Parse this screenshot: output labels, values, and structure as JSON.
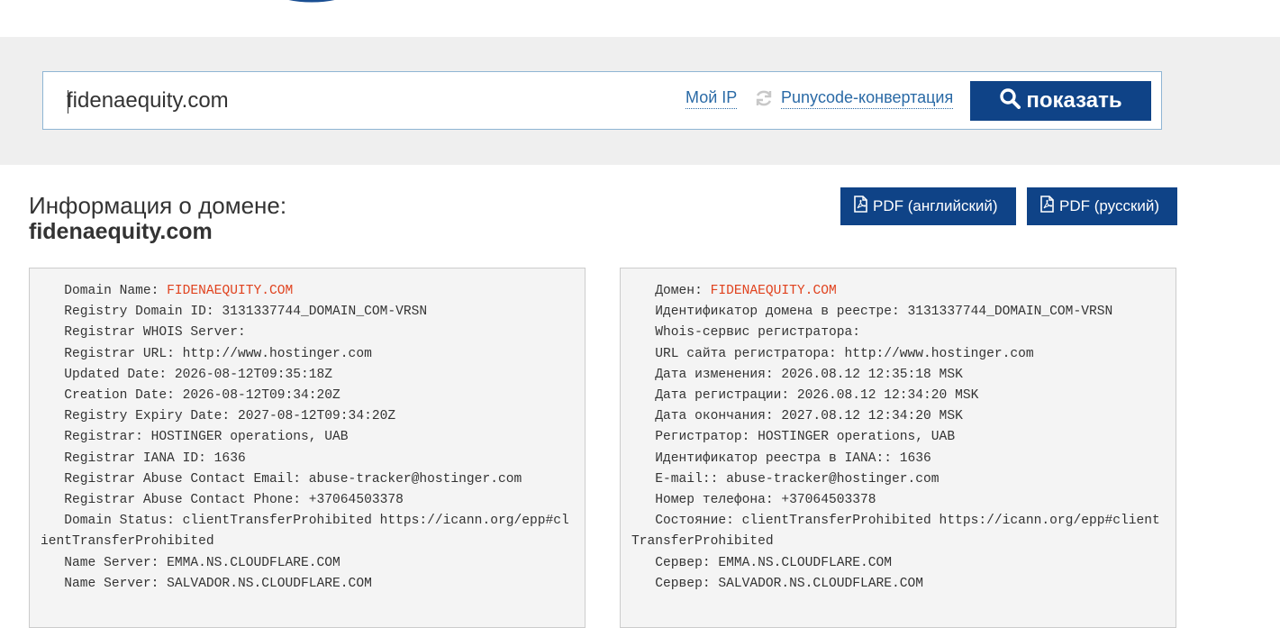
{
  "search": {
    "value": "fidenaequity.com",
    "my_ip_label": "Мой IP",
    "punycode_label": "Punycode-конвертация",
    "show_label": "показать"
  },
  "info": {
    "heading": "Информация о домене:",
    "domain": "fidenaequity.com",
    "pdf_en_label": "PDF (английский)",
    "pdf_ru_label": "PDF (русский)"
  },
  "whois_en": [
    {
      "prefix": "   Domain Name: ",
      "value": "FIDENAEQUITY.COM"
    },
    {
      "text": "   Registry Domain ID: 3131337744_DOMAIN_COM-VRSN"
    },
    {
      "text": "   Registrar WHOIS Server:"
    },
    {
      "text": "   Registrar URL: http://www.hostinger.com"
    },
    {
      "text": "   Updated Date: 2026-08-12T09:35:18Z"
    },
    {
      "text": "   Creation Date: 2026-08-12T09:34:20Z"
    },
    {
      "text": "   Registry Expiry Date: 2027-08-12T09:34:20Z"
    },
    {
      "text": "   Registrar: HOSTINGER operations, UAB"
    },
    {
      "text": "   Registrar IANA ID: 1636"
    },
    {
      "text": "   Registrar Abuse Contact Email: abuse-tracker@hostinger.com"
    },
    {
      "text": "   Registrar Abuse Contact Phone: +37064503378"
    },
    {
      "text": "   Domain Status: clientTransferProhibited https://icann.org/epp#clientTransferProhibited"
    },
    {
      "text": "   Name Server: EMMA.NS.CLOUDFLARE.COM"
    },
    {
      "text": "   Name Server: SALVADOR.NS.CLOUDFLARE.COM"
    }
  ],
  "whois_ru": [
    {
      "prefix": "   Домен: ",
      "value": "FIDENAEQUITY.COM"
    },
    {
      "text": "   Идентификатор домена в реестре: 3131337744_DOMAIN_COM-VRSN"
    },
    {
      "text": "   Whois-сервис регистратора:"
    },
    {
      "text": "   URL сайта регистратора: http://www.hostinger.com"
    },
    {
      "text": "   Дата изменения: 2026.08.12 12:35:18 MSK"
    },
    {
      "text": "   Дата регистрации: 2026.08.12 12:34:20 MSK"
    },
    {
      "text": "   Дата окончания: 2027.08.12 12:34:20 MSK"
    },
    {
      "text": "   Регистратор: HOSTINGER operations, UAB"
    },
    {
      "text": "   Идентификатор реестра в IANA:: 1636"
    },
    {
      "text": "   E-mail:: abuse-tracker@hostinger.com"
    },
    {
      "text": "   Номер телефона: +37064503378"
    },
    {
      "text": "   Состояние: clientTransferProhibited https://icann.org/epp#clientTransferProhibited"
    },
    {
      "text": "   Сервер: EMMA.NS.CLOUDFLARE.COM"
    },
    {
      "text": "   Сервер: SALVADOR.NS.CLOUDFLARE.COM"
    }
  ],
  "colors": {
    "brand": "#0f4387",
    "link": "#2a6aa6",
    "highlight": "#e0431f",
    "band": "#efefef",
    "panel": "#f4f4f4"
  }
}
